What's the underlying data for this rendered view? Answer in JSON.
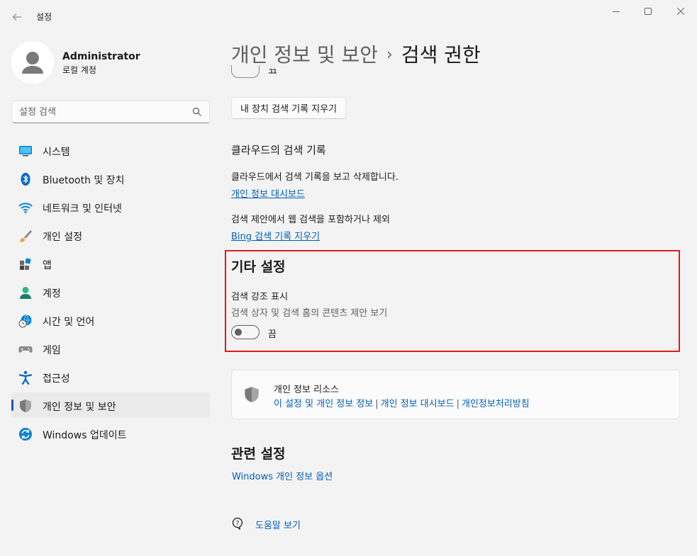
{
  "window": {
    "title": "설정",
    "controls": {
      "minimize": "—",
      "maximize": "☐",
      "close": "✕"
    }
  },
  "profile": {
    "name": "Administrator",
    "account_type": "로컬 계정"
  },
  "search": {
    "placeholder": "설정 검색"
  },
  "nav": {
    "items": [
      {
        "label": "시스템",
        "icon": "system-icon"
      },
      {
        "label": "Bluetooth 및 장치",
        "icon": "bluetooth-icon"
      },
      {
        "label": "네트워크 및 인터넷",
        "icon": "wifi-icon"
      },
      {
        "label": "개인 설정",
        "icon": "brush-icon"
      },
      {
        "label": "앱",
        "icon": "apps-icon"
      },
      {
        "label": "계정",
        "icon": "account-icon"
      },
      {
        "label": "시간 및 언어",
        "icon": "globe-clock-icon"
      },
      {
        "label": "게임",
        "icon": "gamepad-icon"
      },
      {
        "label": "접근성",
        "icon": "accessibility-icon"
      },
      {
        "label": "개인 정보 및 보안",
        "icon": "shield-icon",
        "active": true
      },
      {
        "label": "Windows 업데이트",
        "icon": "update-icon"
      }
    ]
  },
  "breadcrumb": {
    "parent": "개인 정보 및 보안",
    "separator": "›",
    "current": "검색 권한"
  },
  "device_history": {
    "cut_toggle_label": "끔",
    "clear_button": "내 장치 검색 기록 지우기"
  },
  "cloud_history": {
    "heading": "클라우드의 검색 기록",
    "description": "클라우드에서 검색 기록을 보고 삭제합니다.",
    "dashboard_link": "개인 정보 대시보드",
    "bing_description": "검색 제안에서 웹 검색을 포함하거나 제외",
    "bing_link": "Bing 검색 기록 지우기"
  },
  "other_settings": {
    "heading": "기타 설정",
    "highlights_title": "검색 강조 표시",
    "highlights_description": "검색 상자 및 검색 홈의 콘텐츠 제안 보기",
    "toggle_state": "끔",
    "toggle_on": false
  },
  "privacy_resources": {
    "title": "개인 정보 리소스",
    "links": [
      "이 설정 및 개인 정보 정보",
      "개인 정보 대시보드",
      "개인정보처리방침"
    ],
    "separator": "|"
  },
  "related": {
    "heading": "관련 설정",
    "windows_privacy_link": "Windows 개인 정보 옵션"
  },
  "help": {
    "label": "도움말 보기"
  },
  "colors": {
    "accent": "#005fb8",
    "highlight_border": "#e01b1b",
    "background": "#f3f3f3"
  }
}
